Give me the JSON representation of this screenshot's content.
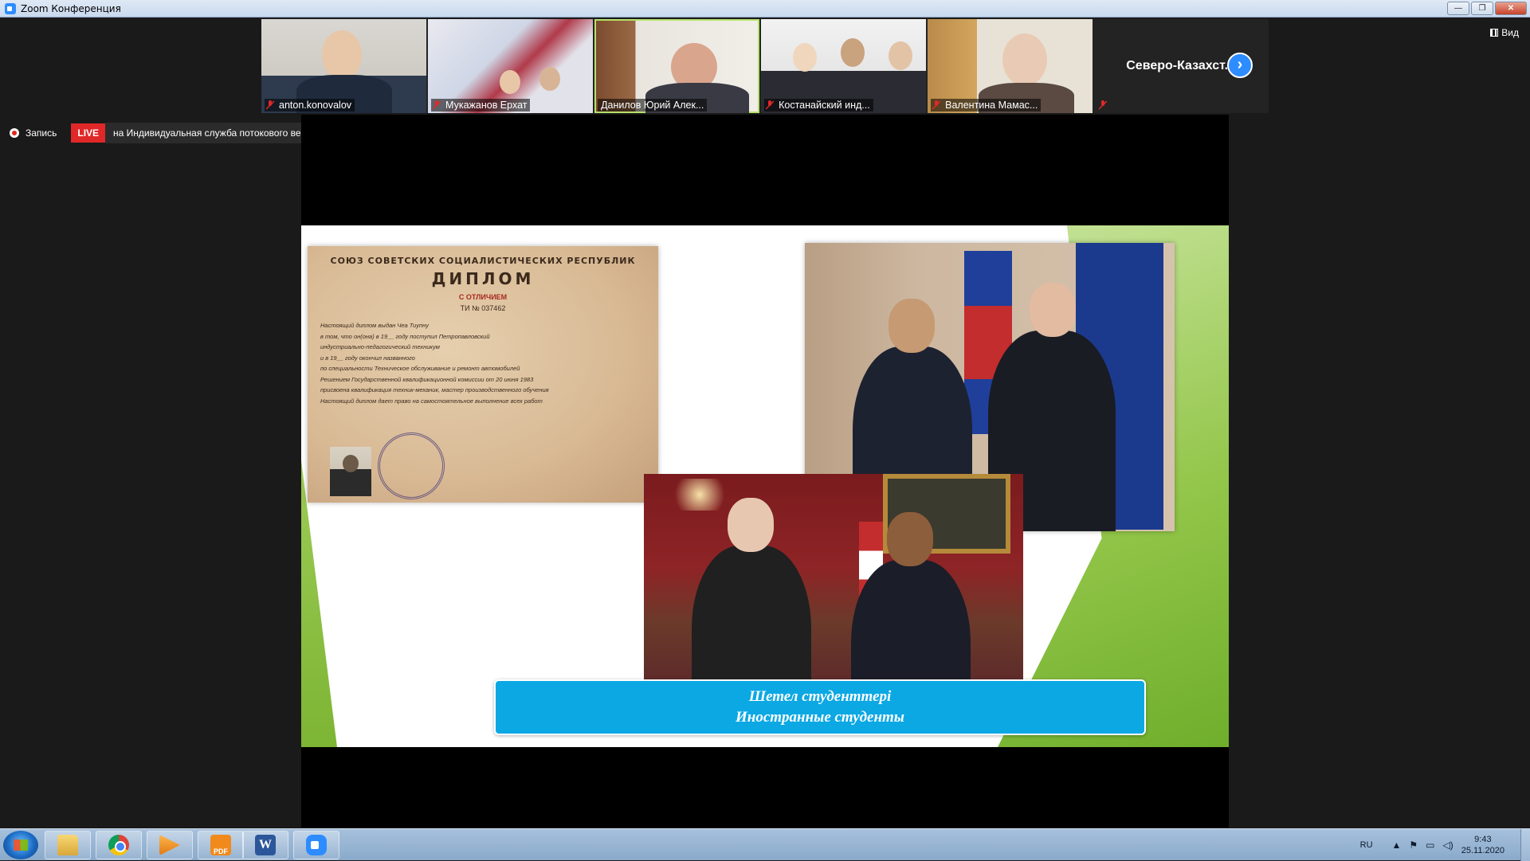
{
  "window": {
    "title": "Zoom Конференция",
    "buttons": [
      "—",
      "❐",
      "✕"
    ]
  },
  "gallery": {
    "participants": [
      {
        "name": "anton.konovalov",
        "muted": true
      },
      {
        "name": "Мукажанов Ерхат",
        "muted": true
      },
      {
        "name": "Данилов Юрий Алек...",
        "muted": false,
        "active_speaker": true
      },
      {
        "name": "Костанайский инд...",
        "muted": true
      },
      {
        "name": "Валентина Мамас...",
        "muted": true
      },
      {
        "name": "Северо-Казахст...",
        "muted": true
      }
    ],
    "next_icon": "›",
    "view_label": "Вид"
  },
  "recording": {
    "label": "Запись",
    "live_badge": "LIVE",
    "stream_label": "на Индивидуальная служба потокового вещания",
    "caret": "▾"
  },
  "slide": {
    "diploma": {
      "header": "СОЮЗ СОВЕТСКИХ СОЦИАЛИСТИЧЕСКИХ РЕСПУБЛИК",
      "title": "ДИПЛОМ",
      "subtitle": "С ОТЛИЧИЕМ",
      "number": "ТИ   № 037462",
      "lines": [
        "Настоящий диплом выдан  Чеа Тиупну",
        "в том, что он(она) в 19__ году поступил  Петропавловский",
        "индустриально-педагогический техникум",
        "и в 19__ году окончил  названного",
        "по специальности  Техническое обслуживание и ремонт автомобилей",
        "Решением Государственной квалификационной комиссии от 20 июня 1983",
        "присвоена квалификация  техник-механик, мастер производственного обучения",
        "Настоящий диплом дает право на самостоятельное выполнение всех работ"
      ]
    },
    "caption_line1": "Шетел студенттері",
    "caption_line2": "Иностранные студенты"
  },
  "taskbar": {
    "apps": [
      "start-button",
      "file-explorer",
      "chrome",
      "media-player",
      "pdf-reader",
      "word",
      "zoom"
    ],
    "pdf_label": "PDF",
    "word_label": "W",
    "lang": "RU",
    "tray_arrow": "▲",
    "time": "9:43",
    "date": "25.11.2020"
  },
  "colors": {
    "live_red": "#e02828",
    "zoom_blue": "#2d8cff",
    "caption_blue": "#0ba8e4",
    "active_border": "#b7e16b"
  }
}
